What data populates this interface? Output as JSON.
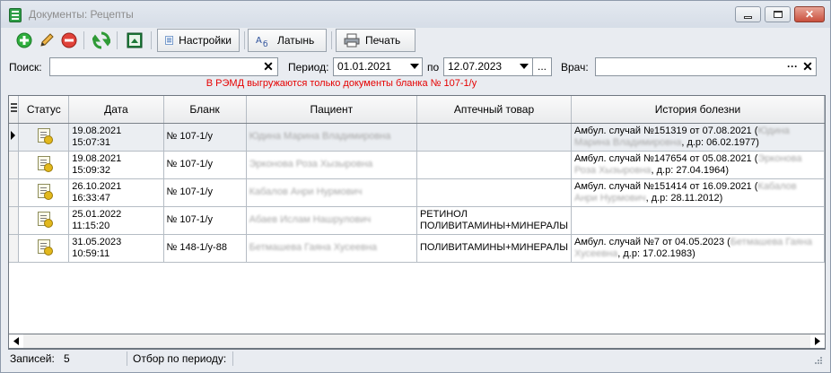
{
  "window": {
    "title": "Документы: Рецепты",
    "close_glyph": "✕"
  },
  "toolbar": {
    "icons": [
      "add-icon",
      "edit-icon",
      "delete-icon",
      "refresh-icon",
      "excel-icon"
    ],
    "settings_label": "Настройки",
    "latin_label": "Латынь",
    "print_label": "Печать"
  },
  "filter": {
    "search_label": "Поиск:",
    "search_value": "",
    "period_label": "Период:",
    "date_from": "01.01.2021",
    "to_label": "по",
    "date_to": "12.07.2023",
    "more_label": "...",
    "doctor_label": "Врач:",
    "doctor_value": "",
    "doctor_more_label": "···",
    "clear_glyph": "✕"
  },
  "notice": "В РЭМД выгружаются только документы бланка № 107-1/у",
  "table": {
    "columns": [
      "Статус",
      "Дата",
      "Бланк",
      "Пациент",
      "Аптечный товар",
      "История болезни"
    ],
    "rows": [
      {
        "date": "19.08.2021",
        "time": "15:07:31",
        "blank": "№ 107-1/у",
        "patient": "Юдина Марина Владимировна",
        "goods": "",
        "history": "Амбул. случай №151319 от 07.08.2021 (",
        "history_name": "Юдина Марина Владимировна",
        "history_tail": ", д.р: 06.02.1977)"
      },
      {
        "date": "19.08.2021",
        "time": "15:09:32",
        "blank": "№ 107-1/у",
        "patient": "Эрконова Роза Хызыровна",
        "goods": "",
        "history": "Амбул. случай №147654 от 05.08.2021 (",
        "history_name": "Эрконова Роза Хызыровна",
        "history_tail": ", д.р: 27.04.1964)"
      },
      {
        "date": "26.10.2021",
        "time": "16:33:47",
        "blank": "№ 107-1/у",
        "patient": "Кабалов Анри Нурмович",
        "goods": "",
        "history": "Амбул. случай №151414 от 16.09.2021 (",
        "history_name": "Кабалов Анри Нурмович",
        "history_tail": ", д.р: 28.11.2012)"
      },
      {
        "date": "25.01.2022",
        "time": "11:15:20",
        "blank": "№ 107-1/у",
        "patient": "Абаев Ислам Нашрулович",
        "goods": "РЕТИНОЛ",
        "goods2": "ПОЛИВИТАМИНЫ+МИНЕРАЛЫ",
        "history": "",
        "history_name": "",
        "history_tail": ""
      },
      {
        "date": "31.05.2023",
        "time": "10:59:11",
        "blank": "№ 148-1/у-88",
        "patient": "Бетмашева Гаяна Хусеевна",
        "goods": "ПОЛИВИТАМИНЫ+МИНЕРАЛЫ",
        "goods2": "",
        "history": "Амбул. случай №7 от 04.05.2023 (",
        "history_name": "Бетмашева Гаяна Хусеевна",
        "history_tail": ", д.р: 17.02.1983)"
      }
    ]
  },
  "status": {
    "records_label": "Записей:",
    "records_value": "5",
    "period_filter_label": "Отбор по периоду:"
  }
}
